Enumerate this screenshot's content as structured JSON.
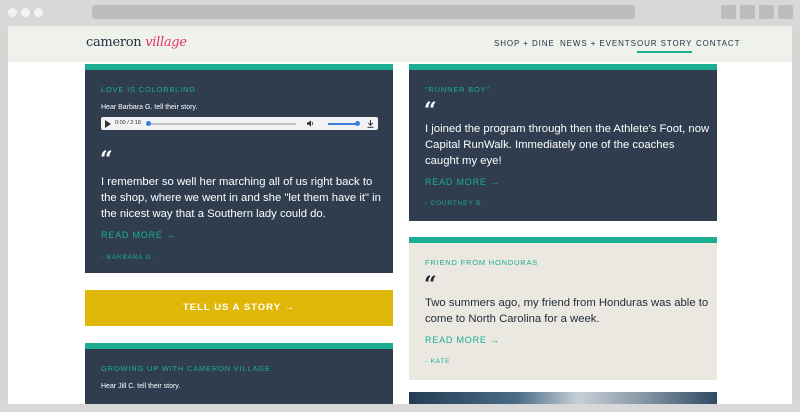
{
  "header": {
    "logo_main": "cameron",
    "logo_accent": "village",
    "nav": [
      {
        "label": "SHOP + DINE"
      },
      {
        "label": "NEWS + EVENTS"
      },
      {
        "label": "OUR STORY"
      },
      {
        "label": "CONTACT"
      }
    ],
    "active_nav": "OUR STORY"
  },
  "cards": {
    "love": {
      "title": "LOVE IS COLORBLIND",
      "subtitle": "Hear Barbara G. tell their story.",
      "audio_time": "0:00 / 2:18",
      "quote": "I remember so well her marching all of us right back to the shop, where we went in and she \"let them have it\" in the nicest way that a Southern lady could do.",
      "read_more": "READ MORE →",
      "author": "- BARBARA G."
    },
    "runner": {
      "title": "\"RUNNER BOY\"",
      "quote": "I joined the program through then the Athlete's Foot, now Capital RunWalk. Immediately one of the coaches caught my eye!",
      "read_more": "READ MORE →",
      "author": "- COURTNEY B."
    },
    "honduras": {
      "title": "FRIEND FROM HONDURAS",
      "quote": "Two summers ago, my friend from Honduras was able to come to North Carolina for a week.",
      "read_more": "READ MORE →",
      "author": "- KATE"
    },
    "growing": {
      "title": "GROWING UP WITH CAMERON VILLAGE",
      "subtitle": "Hear Jill C. tell their story."
    }
  },
  "quote_glyph": "“",
  "cta": {
    "label": "TELL US A STORY →"
  },
  "colors": {
    "teal": "#1cae93",
    "navy": "#2f3d4f",
    "beige": "#eae8e1",
    "gold": "#dfb707",
    "pink": "#e0356b"
  }
}
